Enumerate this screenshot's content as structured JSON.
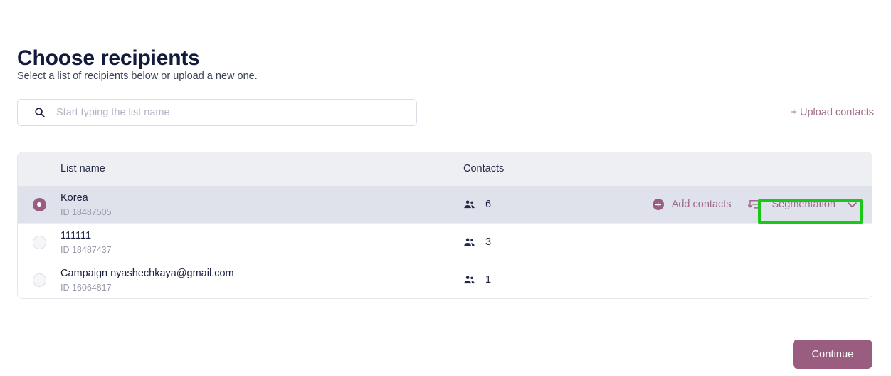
{
  "header": {
    "title": "Choose recipients",
    "subtitle": "Select a list of recipients below or upload a new one."
  },
  "search": {
    "placeholder": "Start typing the list name",
    "value": "",
    "icon": "search-icon"
  },
  "upload_link": {
    "label": "+ Upload contacts"
  },
  "table": {
    "columns": {
      "list_name": "List name",
      "contacts": "Contacts"
    },
    "rows": [
      {
        "name": "Korea",
        "id_label": "ID 18487505",
        "contacts": "6",
        "selected": true,
        "add_contacts_label": "Add contacts",
        "segmentation_label": "Segmentation"
      },
      {
        "name": "111111",
        "id_label": "ID 18487437",
        "contacts": "3",
        "selected": false
      },
      {
        "name": "Campaign nyashechkaya@gmail.com",
        "id_label": "ID 16064817",
        "contacts": "1",
        "selected": false
      }
    ]
  },
  "footer": {
    "continue_label": "Continue"
  },
  "colors": {
    "accent": "#9a5d80",
    "accent_text": "#9e6a8a",
    "selected_row": "#dfe2ea",
    "header_row": "#eeeff2",
    "highlight": "#18c718",
    "title": "#141a3c"
  }
}
